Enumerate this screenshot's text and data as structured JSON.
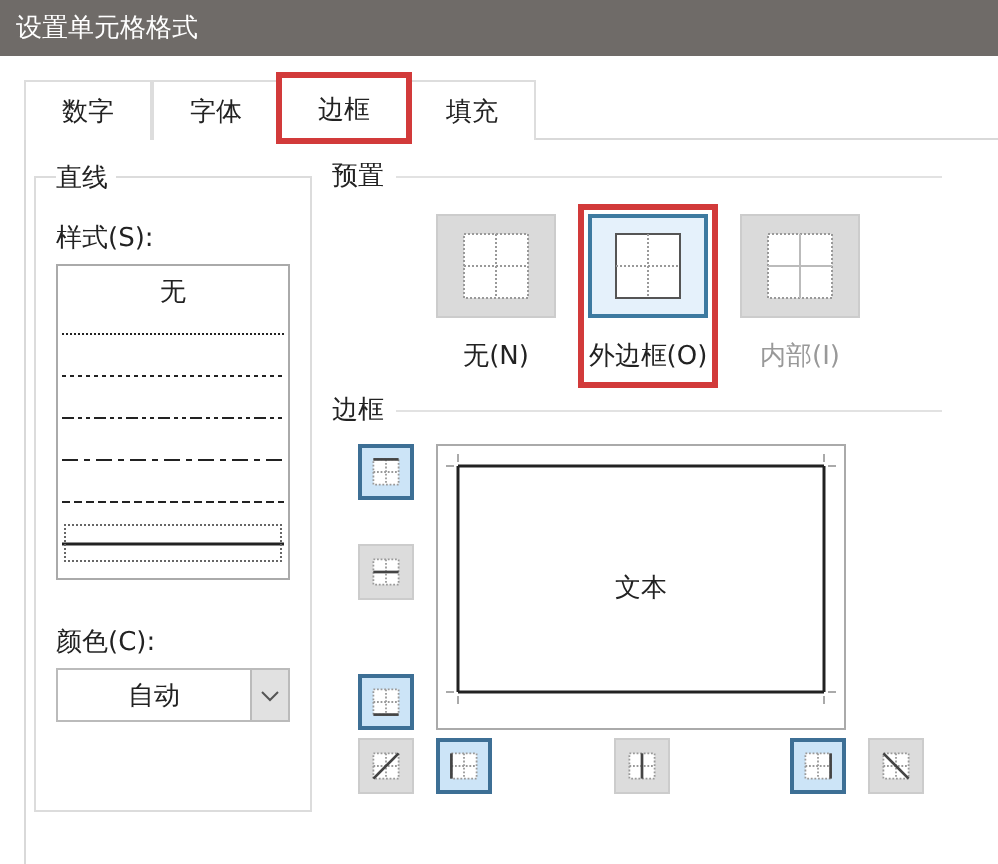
{
  "window": {
    "title": "设置单元格格式"
  },
  "tabs": [
    {
      "label": "数字",
      "selected": false,
      "highlighted": false
    },
    {
      "label": "字体",
      "selected": false,
      "highlighted": false
    },
    {
      "label": "边框",
      "selected": true,
      "highlighted": true
    },
    {
      "label": "填充",
      "selected": false,
      "highlighted": false
    }
  ],
  "line": {
    "title": "直线",
    "style_label": "样式(S):",
    "styles": [
      {
        "kind": "none",
        "label": "无",
        "selected": false
      },
      {
        "kind": "hair",
        "selected": false
      },
      {
        "kind": "dotted",
        "selected": false
      },
      {
        "kind": "dashdotdot",
        "selected": false
      },
      {
        "kind": "dashdot",
        "selected": false
      },
      {
        "kind": "dashed",
        "selected": false
      },
      {
        "kind": "thin",
        "selected": true
      }
    ],
    "color_label": "颜色(C):",
    "color_value": "自动"
  },
  "presets": {
    "title": "预置",
    "items": [
      {
        "kind": "none",
        "label": "无(N)",
        "selected": false,
        "disabled": false,
        "highlighted": false
      },
      {
        "kind": "outline",
        "label": "外边框(O)",
        "selected": true,
        "disabled": false,
        "highlighted": true
      },
      {
        "kind": "inside",
        "label": "内部(I)",
        "selected": false,
        "disabled": true,
        "highlighted": false
      }
    ]
  },
  "border": {
    "title": "边框",
    "preview_text": "文本",
    "buttons": [
      {
        "kind": "top",
        "pressed": true
      },
      {
        "kind": "middle-h",
        "pressed": false
      },
      {
        "kind": "bottom",
        "pressed": true
      },
      {
        "kind": "diag-up",
        "pressed": false
      },
      {
        "kind": "left",
        "pressed": true
      },
      {
        "kind": "middle-v",
        "pressed": false
      },
      {
        "kind": "right",
        "pressed": true
      },
      {
        "kind": "diag-down",
        "pressed": false
      }
    ]
  }
}
